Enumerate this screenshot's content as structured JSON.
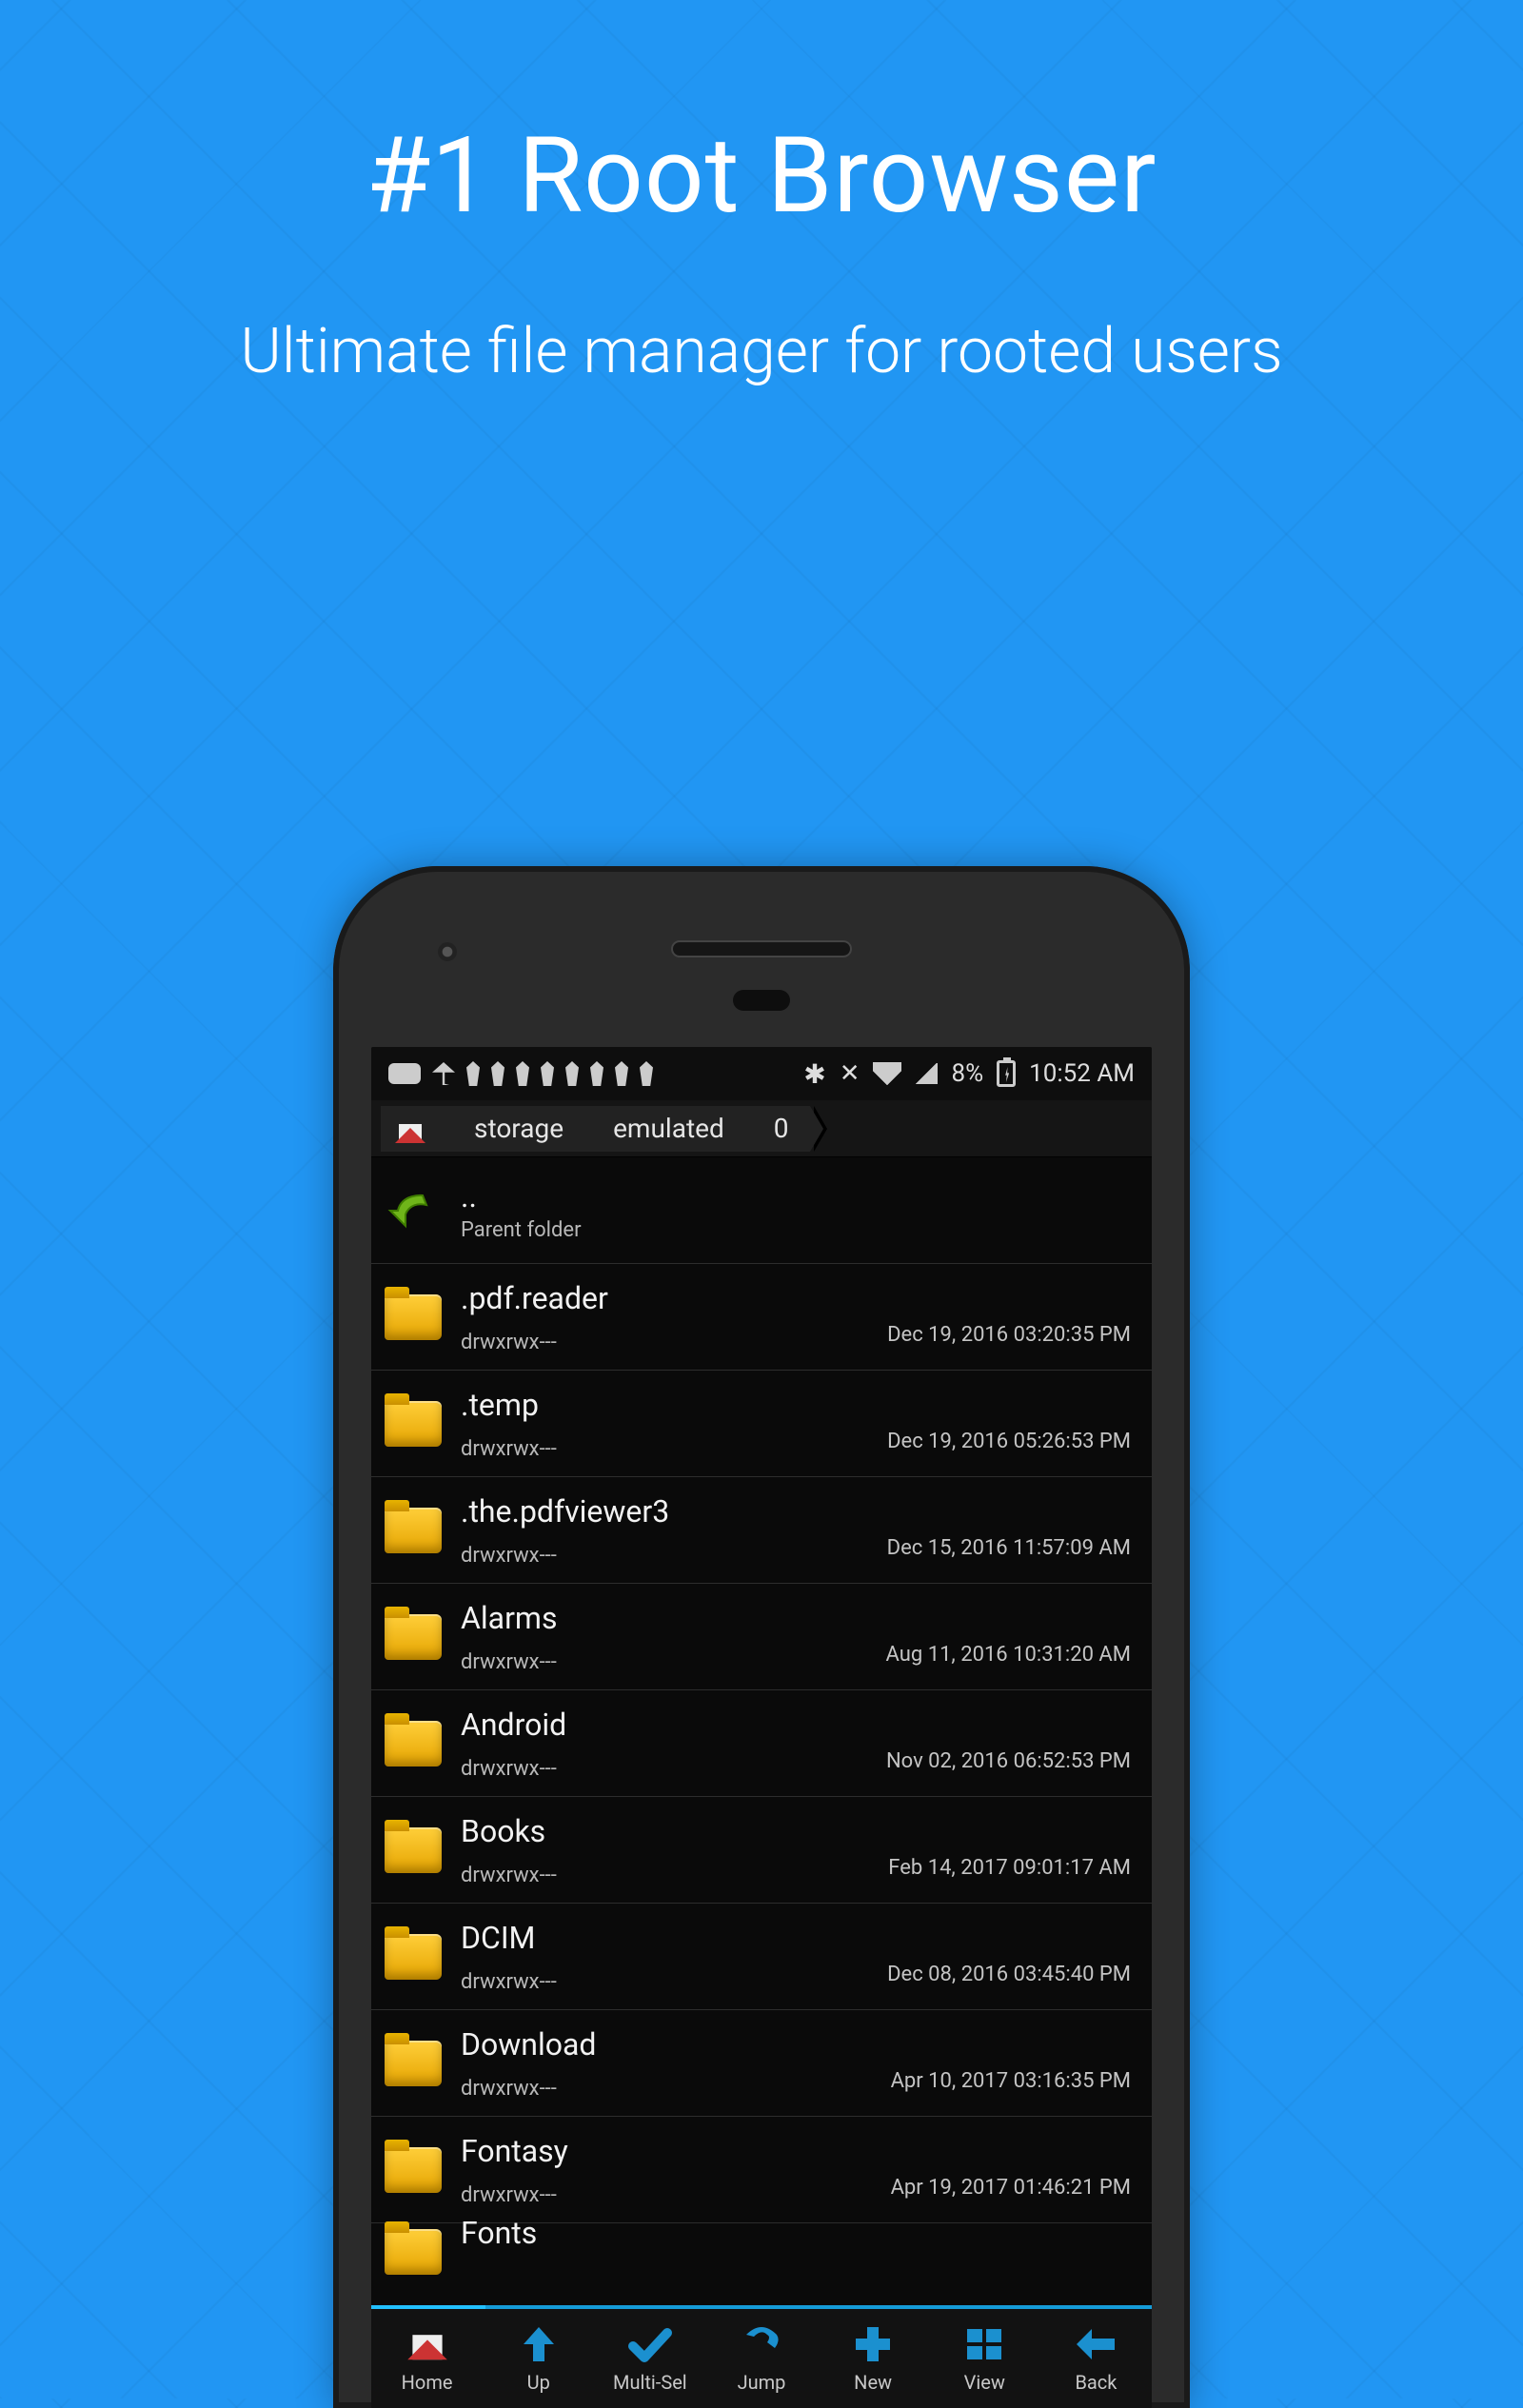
{
  "marketing": {
    "headline": "#1 Root Browser",
    "subline": "Ultimate file manager for rooted users"
  },
  "status_bar": {
    "battery_pct": "8%",
    "time": "10:52 AM"
  },
  "breadcrumb": [
    "storage",
    "emulated",
    "0"
  ],
  "parent": {
    "label": "..",
    "sub": "Parent folder"
  },
  "entries": [
    {
      "name": ".pdf.reader",
      "perm": "drwxrwx---",
      "date": "Dec 19, 2016 03:20:35 PM"
    },
    {
      "name": ".temp",
      "perm": "drwxrwx---",
      "date": "Dec 19, 2016 05:26:53 PM"
    },
    {
      "name": ".the.pdfviewer3",
      "perm": "drwxrwx---",
      "date": "Dec 15, 2016 11:57:09 AM"
    },
    {
      "name": "Alarms",
      "perm": "drwxrwx---",
      "date": "Aug 11, 2016 10:31:20 AM"
    },
    {
      "name": "Android",
      "perm": "drwxrwx---",
      "date": "Nov 02, 2016 06:52:53 PM"
    },
    {
      "name": "Books",
      "perm": "drwxrwx---",
      "date": "Feb 14, 2017 09:01:17 AM"
    },
    {
      "name": "DCIM",
      "perm": "drwxrwx---",
      "date": "Dec 08, 2016 03:45:40 PM"
    },
    {
      "name": "Download",
      "perm": "drwxrwx---",
      "date": "Apr 10, 2017 03:16:35 PM"
    },
    {
      "name": "Fontasy",
      "perm": "drwxrwx---",
      "date": "Apr 19, 2017 01:46:21 PM"
    },
    {
      "name": "Fonts",
      "perm": "",
      "date": ""
    }
  ],
  "toolbar": [
    {
      "id": "home",
      "label": "Home"
    },
    {
      "id": "up",
      "label": "Up"
    },
    {
      "id": "multisel",
      "label": "Multi-Sel"
    },
    {
      "id": "jump",
      "label": "Jump"
    },
    {
      "id": "new",
      "label": "New"
    },
    {
      "id": "view",
      "label": "View"
    },
    {
      "id": "back",
      "label": "Back"
    }
  ],
  "colors": {
    "accent": "#1b90cf"
  }
}
